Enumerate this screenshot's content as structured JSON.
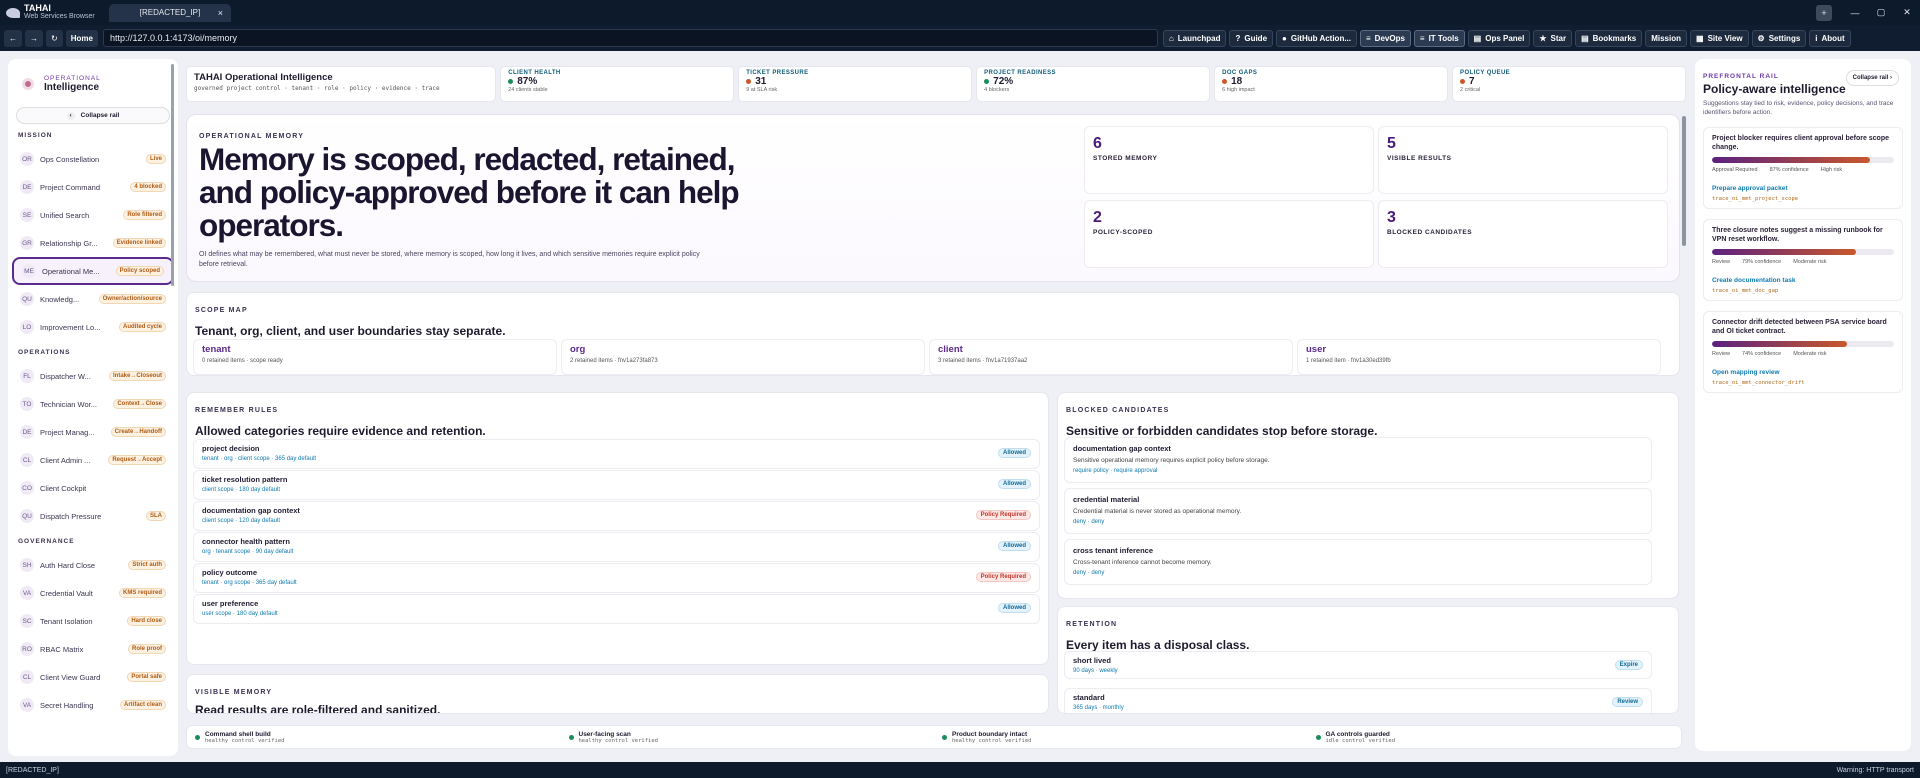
{
  "window": {
    "brand": "TAHAI",
    "brand_sub": "Web Services Browser",
    "tab": "[REDACTED_IP]",
    "tab_close": "×",
    "new_tab": "+",
    "minimize": "—",
    "maximize": "▢",
    "close": "✕"
  },
  "nav": {
    "back": "←",
    "forward": "→",
    "reload": "↻",
    "home": "Home",
    "url": "http://127.0.0.1:4173/oi/memory"
  },
  "toolbar": [
    {
      "icon": "⌂",
      "label": "Launchpad"
    },
    {
      "icon": "?",
      "label": "Guide"
    },
    {
      "icon": "●",
      "label": "GitHub Action..."
    },
    {
      "icon": "≡",
      "label": "DevOps"
    },
    {
      "icon": "≡",
      "label": "IT Tools"
    },
    {
      "icon": "▤",
      "label": "Ops Panel"
    },
    {
      "icon": "★",
      "label": "Star"
    },
    {
      "icon": "▤",
      "label": "Bookmarks"
    },
    {
      "icon": "",
      "label": "Mission"
    },
    {
      "icon": "▦",
      "label": "Site View"
    },
    {
      "icon": "⚙",
      "label": "Settings"
    },
    {
      "icon": "i",
      "label": "About"
    }
  ],
  "sidebar": {
    "kicker": "OPERATIONAL",
    "title": "Intelligence",
    "collapse": "Collapse rail",
    "sections": [
      {
        "title": "MISSION",
        "items": [
          {
            "ab": "OR",
            "label": "Ops Constellation",
            "badge": "Live"
          },
          {
            "ab": "DE",
            "label": "Project Command",
            "badge": "4 blocked"
          },
          {
            "ab": "SE",
            "label": "Unified Search",
            "badge": "Role filtered"
          },
          {
            "ab": "GR",
            "label": "Relationship Gr...",
            "badge": "Evidence linked"
          },
          {
            "ab": "ME",
            "label": "Operational Me...",
            "badge": "Policy scoped"
          },
          {
            "ab": "QU",
            "label": "Knowledg...",
            "badge": "Owner/action/source"
          },
          {
            "ab": "LO",
            "label": "Improvement Lo...",
            "badge": "Audited cycle"
          }
        ]
      },
      {
        "title": "OPERATIONS",
        "items": [
          {
            "ab": "FL",
            "label": "Dispatcher W...",
            "badge": "Intake→Closeout"
          },
          {
            "ab": "TO",
            "label": "Technician Wor...",
            "badge": "Context→Close"
          },
          {
            "ab": "DE",
            "label": "Project Manag...",
            "badge": "Create→Handoff"
          },
          {
            "ab": "CL",
            "label": "Client Admin ...",
            "badge": "Request→Accept"
          },
          {
            "ab": "CO",
            "label": "Client Cockpit",
            "badge": ""
          },
          {
            "ab": "QU",
            "label": "Dispatch Pressure",
            "badge": "SLA"
          }
        ]
      },
      {
        "title": "GOVERNANCE",
        "items": [
          {
            "ab": "SH",
            "label": "Auth Hard Close",
            "badge": "Strict auth"
          },
          {
            "ab": "VA",
            "label": "Credential Vault",
            "badge": "KMS required"
          },
          {
            "ab": "SC",
            "label": "Tenant Isolation",
            "badge": "Hard close"
          },
          {
            "ab": "RO",
            "label": "RBAC Matrix",
            "badge": "Role proof"
          },
          {
            "ab": "CL",
            "label": "Client View Guard",
            "badge": "Portal safe"
          },
          {
            "ab": "VA",
            "label": "Secret Handling",
            "badge": "Artifact clean"
          }
        ]
      }
    ]
  },
  "kpis": {
    "title": "TAHAI Operational Intelligence",
    "sub": "governed project control · tenant · role · policy · evidence · trace",
    "items": [
      {
        "t": "CLIENT HEALTH",
        "v": "87%",
        "s": "24 clients stable",
        "c": "#1a8d5d"
      },
      {
        "t": "TICKET PRESSURE",
        "v": "31",
        "s": "9 at SLA risk",
        "c": "#c9582c"
      },
      {
        "t": "PROJECT READINESS",
        "v": "72%",
        "s": "4 blockers",
        "c": "#1a8d5d"
      },
      {
        "t": "DOC GAPS",
        "v": "18",
        "s": "6 high impact",
        "c": "#c9582c"
      },
      {
        "t": "POLICY QUEUE",
        "v": "7",
        "s": "2 critical",
        "c": "#c9582c"
      }
    ]
  },
  "hero": {
    "kicker": "OPERATIONAL MEMORY",
    "title": "Memory is scoped, redacted, retained, and policy-approved before it can help operators.",
    "desc": "OI defines what may be remembered, what must never be stored, where memory is scoped, how long it lives, and which sensitive memories require explicit policy before retrieval.",
    "stats": [
      {
        "v": "6",
        "l": "STORED MEMORY"
      },
      {
        "v": "5",
        "l": "VISIBLE RESULTS"
      },
      {
        "v": "2",
        "l": "POLICY-SCOPED"
      },
      {
        "v": "3",
        "l": "BLOCKED CANDIDATES"
      }
    ]
  },
  "scope": {
    "kicker": "SCOPE MAP",
    "title": "Tenant, org, client, and user boundaries stay separate.",
    "cells": [
      {
        "n": "tenant",
        "d": "0 retained items · scope ready"
      },
      {
        "n": "org",
        "d": "2 retained items · fnv1a273fa873"
      },
      {
        "n": "client",
        "d": "3 retained items · fnv1a71937aa2"
      },
      {
        "n": "user",
        "d": "1 retained item · fnv1a30ed39fb"
      }
    ]
  },
  "rules": {
    "kicker": "REMEMBER RULES",
    "title": "Allowed categories require evidence and retention.",
    "items": [
      {
        "n": "project decision",
        "d": "tenant · org · client scope · 365 day default",
        "s": "Allowed"
      },
      {
        "n": "ticket resolution pattern",
        "d": "client scope · 180 day default",
        "s": "Allowed"
      },
      {
        "n": "documentation gap context",
        "d": "client scope · 120 day default",
        "s": "Policy Required"
      },
      {
        "n": "connector health pattern",
        "d": "org · tenant scope · 90 day default",
        "s": "Allowed"
      },
      {
        "n": "policy outcome",
        "d": "tenant · org scope · 365 day default",
        "s": "Policy Required"
      },
      {
        "n": "user preference",
        "d": "user scope · 180 day default",
        "s": "Allowed"
      }
    ]
  },
  "visible": {
    "kicker": "VISIBLE MEMORY",
    "title": "Read results are role-filtered and sanitized."
  },
  "blocked": {
    "kicker": "BLOCKED CANDIDATES",
    "title": "Sensitive or forbidden candidates stop before storage.",
    "items": [
      {
        "n": "documentation gap context",
        "p": "Sensitive operational memory requires explicit policy before storage.",
        "s": "require policy · require approval"
      },
      {
        "n": "credential material",
        "p": "Credential material is never stored as operational memory.",
        "s": "deny · deny"
      },
      {
        "n": "cross tenant inference",
        "p": "Cross-tenant inference cannot become memory.",
        "s": "deny · deny"
      }
    ]
  },
  "retention": {
    "kicker": "RETENTION",
    "title": "Every item has a disposal class.",
    "items": [
      {
        "n": "short lived",
        "d": "90 days · weekly",
        "s": "Expire"
      },
      {
        "n": "standard",
        "d": "365 days · monthly",
        "s": "Review"
      }
    ]
  },
  "controls": [
    {
      "n": "Command shell build",
      "s": "healthy control verified"
    },
    {
      "n": "User-facing scan",
      "s": "healthy control verified"
    },
    {
      "n": "Product boundary intact",
      "s": "healthy control verified"
    },
    {
      "n": "GA controls guarded",
      "s": "idle control verified"
    }
  ],
  "rail": {
    "kicker": "PREFRONTAL RAIL",
    "title": "Policy-aware intelligence",
    "desc": "Suggestions stay tied to risk, evidence, policy decisions, and trace identifiers before action.",
    "collapse": "Collapse rail",
    "cards": [
      {
        "t": "Project blocker requires client approval before scope change.",
        "fill": 0.87,
        "m": [
          "Approval Required",
          "87% confidence",
          "High risk"
        ],
        "a": "Prepare approval packet",
        "tr": "trace_oi_mmt_project_scope"
      },
      {
        "t": "Three closure notes suggest a missing runbook for VPN reset workflow.",
        "fill": 0.79,
        "m": [
          "Review",
          "79% confidence",
          "Moderate risk"
        ],
        "a": "Create documentation task",
        "tr": "trace_oi_mmt_doc_gap"
      },
      {
        "t": "Connector drift detected between PSA service board and OI ticket contract.",
        "fill": 0.74,
        "m": [
          "Review",
          "74% confidence",
          "Moderate risk"
        ],
        "a": "Open mapping review",
        "tr": "trace_oi_mmt_connector_drift"
      }
    ]
  },
  "status": {
    "left": "[REDACTED_IP]",
    "right": "Warning: HTTP transport"
  }
}
